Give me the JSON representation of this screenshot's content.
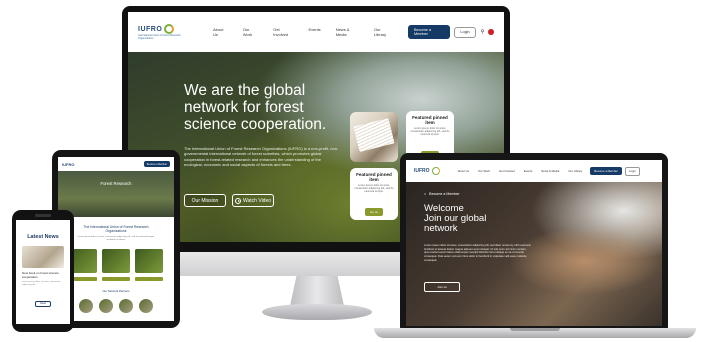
{
  "desktop": {
    "logo_text": "IUFRO",
    "logo_subtitle": "International Union of Forest Research Organizations",
    "nav_links": [
      "About Us",
      "Our Work",
      "Get Involved",
      "Events",
      "News & Media",
      "Our Library"
    ],
    "become_member_label": "Become a Member",
    "login_label": "Login",
    "hero_title": "We are the global network for forest science cooperation.",
    "hero_body": "The International Union of Forest Research Organizations (IUFRO) is a non-profit, non-governmental international network of forest scientists, which promotes global cooperation in forest-related research and enhances the understanding of the ecological, economic and social aspects of forests and trees.",
    "our_mission_label": "Our Mission",
    "watch_video_label": "Watch Video",
    "pinned_cards": [
      {
        "title": "Featured pinned item",
        "text": "Lorem ipsum dolor sit amet, consectetur adipiscing elit, sed do eiusmod tempor.",
        "button": "Go on"
      },
      {
        "title": "Featured pinned item",
        "text": "Lorem ipsum dolor sit amet, consectetur adipiscing elit, sed do eiusmod tempor.",
        "button": "Go on"
      }
    ]
  },
  "tablet": {
    "logo_text": "IUFRO",
    "button_label": "Become a Member",
    "hero_title": "Forest Research",
    "intro_title": "The International Union of Forest Research Organizations",
    "intro_text": "Lorem ipsum dolor sit amet, consectetur adipiscing elit, sed do eiusmod tempor incididunt ut labore.",
    "section_title": "Our Network Partners"
  },
  "phone": {
    "title": "Latest News",
    "headline": "New book on forest science cooperation",
    "text": "Lorem ipsum dolor sit amet, consectetur adipiscing elit.",
    "button_label": "Read"
  },
  "laptop": {
    "logo_text": "IUFRO",
    "nav_links": [
      "About Us",
      "Our Work",
      "Get Involved",
      "Events",
      "News & Media",
      "Our Library"
    ],
    "become_member_label": "Become a Member",
    "login_label": "Login",
    "breadcrumb": "Become a Member",
    "hero_title_line1": "Welcome",
    "hero_title_line2": "Join our global network",
    "hero_text": "Lorem ipsum dolor sit amet, consectetur adipiscing elit, sed diam nonummy nibh euismod tincidunt ut laoreet dolore magna aliquam erat volutpat. Ut wisi enim ad minim veniam, quis nostrud exerci tation ullamcorper suscipit lobortis nisl ut aliquip ex ea commodo consequat. Duis autem vel eum iriure dolor in hendrerit in vulputate velit esse molestie consequat.",
    "join_label": "Join us"
  },
  "colors": {
    "navy": "#153a66",
    "olive": "#8a9a2c",
    "forest": "#3e4d2b"
  }
}
